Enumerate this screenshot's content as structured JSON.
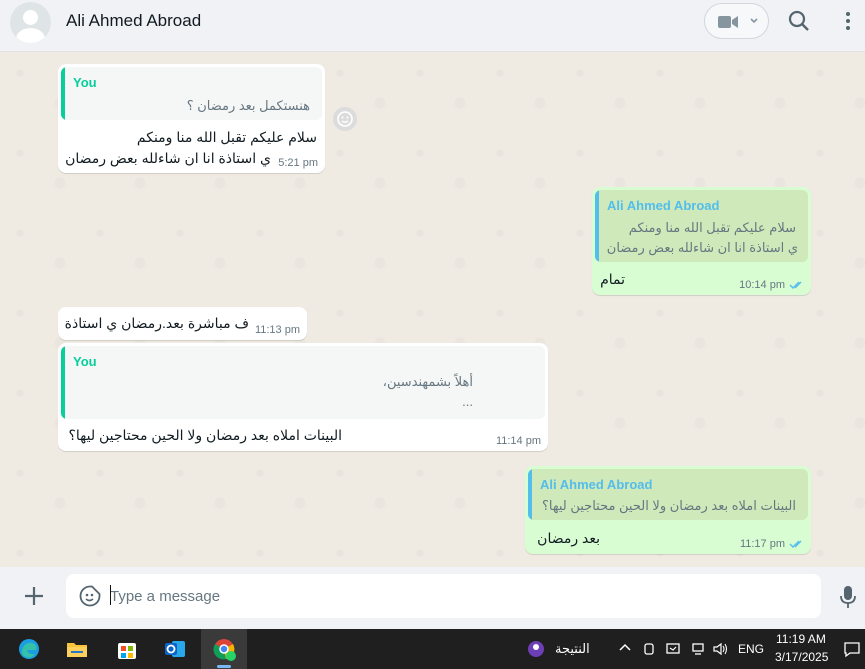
{
  "header": {
    "contact_name": "Ali Ahmed Abroad"
  },
  "messages": [
    {
      "direction": "in",
      "quote": {
        "name": "You",
        "lines": [
          "هنستكمل بعد رمضان ؟"
        ]
      },
      "lines": [
        "سلام عليكم تقبل الله منا ومنكم",
        "ي استاذة انا ان شاءلله بعض رمضان"
      ],
      "time": "5:21 pm"
    },
    {
      "direction": "out",
      "quote": {
        "name": "Ali Ahmed Abroad",
        "lines": [
          "سلام عليكم تقبل الله منا ومنكم",
          "ي استاذة انا ان شاءلله بعض رمضان"
        ]
      },
      "lines": [
        "تمام"
      ],
      "time": "10:14 pm"
    },
    {
      "direction": "in",
      "lines": [
        "ف مباشرة بعد.رمضان ي استاذة"
      ],
      "time": "11:13 pm"
    },
    {
      "direction": "in",
      "quote": {
        "name": "You",
        "lines": [
          "أهلاً بشمهندسين،",
          "..."
        ]
      },
      "lines": [
        "البينات املاه بعد رمضان ولا الحين محتاجين ليها؟"
      ],
      "time": "11:14 pm"
    },
    {
      "direction": "out",
      "quote": {
        "name": "Ali Ahmed Abroad",
        "lines": [
          "البينات املاه بعد رمضان ولا الحين محتاجين ليها؟"
        ]
      },
      "lines": [
        "بعد رمضان"
      ],
      "time": "11:17 pm"
    }
  ],
  "compose": {
    "placeholder": "Type a message"
  },
  "taskbar": {
    "weather_label": "النتيجة",
    "language": "ENG",
    "time": "11:19 AM",
    "date": "3/17/2025"
  },
  "colors": {
    "outgoing_bubble": "#d9fdd3",
    "incoming_bubble": "#ffffff",
    "you_quote_name": "#06cf9c",
    "contact_quote_name": "#53bdeb",
    "read_ticks": "#53bdeb"
  }
}
